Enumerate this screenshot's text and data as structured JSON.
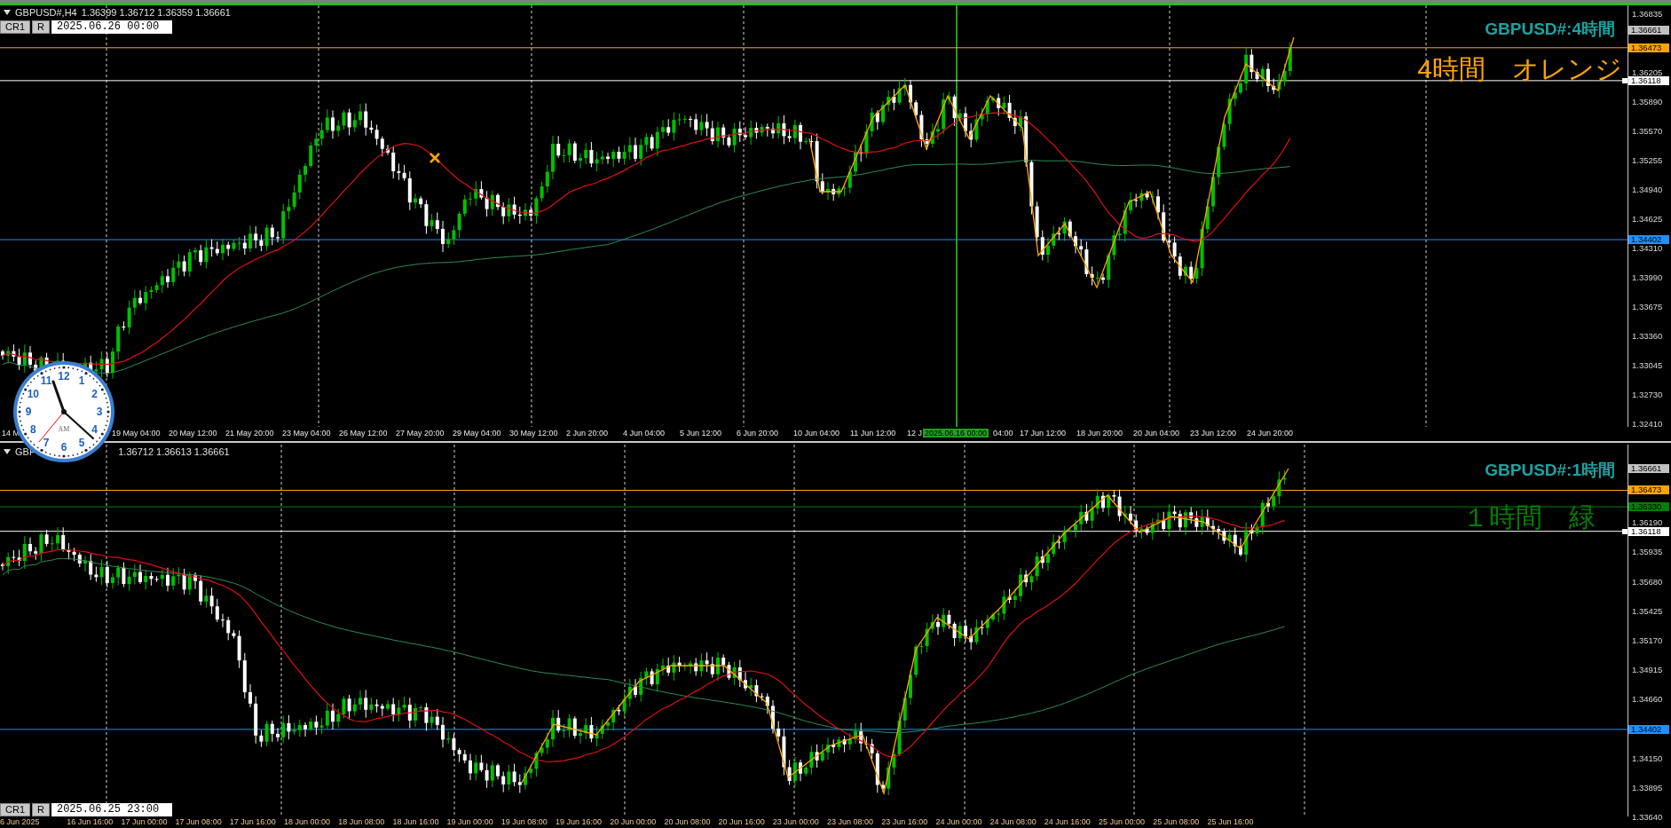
{
  "panes": [
    {
      "symbol": "GBPUSD#,H4",
      "quote": "1.36399 1.36712 1.36359 1.36661",
      "title": "GBPUSD#:4時間",
      "note": {
        "text": "4時間　オレンジ",
        "color": "#ffa500"
      },
      "toolbar": {
        "buttons": [
          "CR1",
          "R"
        ],
        "date": "2025.06.26 00:00"
      },
      "ticks": [
        "1.36835",
        "1.36205",
        "1.35890",
        "1.35570",
        "1.35255",
        "1.34940",
        "1.34625",
        "1.34310",
        "1.33990",
        "1.33675",
        "1.33360",
        "1.33045",
        "1.32730",
        "1.32410"
      ],
      "lines": [
        {
          "price": "1.36661",
          "color": "#c0c0c0",
          "kind": "tag"
        },
        {
          "price": "1.36473",
          "color": "#ffa500",
          "kind": "line"
        },
        {
          "price": "1.36118",
          "color": "#ffffff",
          "kind": "line"
        },
        {
          "price": "1.34402",
          "color": "#1e90ff",
          "kind": "line"
        }
      ],
      "time_labels": [
        {
          "text": "14 M",
          "kind": "tick"
        },
        {
          "text": "19 May 04:00",
          "kind": "tick"
        },
        {
          "text": "20 May 12:00",
          "kind": "tick"
        },
        {
          "text": "21 May 20:00",
          "kind": "tick"
        },
        {
          "text": "23 May 04:00",
          "kind": "tick"
        },
        {
          "text": "26 May 12:00",
          "kind": "tick"
        },
        {
          "text": "27 May 20:00",
          "kind": "tick"
        },
        {
          "text": "29 May 04:00",
          "kind": "tick"
        },
        {
          "text": "30 May 12:00",
          "kind": "tick"
        },
        {
          "text": "2 Jun 20:00",
          "kind": "tick"
        },
        {
          "text": "4 Jun 04:00",
          "kind": "tick"
        },
        {
          "text": "5 Jun 12:00",
          "kind": "tick"
        },
        {
          "text": "6 Jun 20:00",
          "kind": "tick"
        },
        {
          "text": "10 Jun 04:00",
          "kind": "tick"
        },
        {
          "text": "11 Jun 12:00",
          "kind": "tick"
        },
        {
          "text": "12 J",
          "kind": "tick"
        },
        {
          "text": "2025.06.16 00:00",
          "kind": "cursor"
        },
        {
          "text": "04:00",
          "kind": "tick"
        },
        {
          "text": "17 Jun 12:00",
          "kind": "tick"
        },
        {
          "text": "18 Jun 20:00",
          "kind": "tick"
        },
        {
          "text": "20 Jun 04:00",
          "kind": "tick"
        },
        {
          "text": "23 Jun 12:00",
          "kind": "tick"
        },
        {
          "text": "24 Jun 20:00",
          "kind": "tick"
        }
      ]
    },
    {
      "symbol": "GBP",
      "quote": "1.36712 1.36613 1.36661",
      "title": "GBPUSD#:1時間",
      "note": {
        "text": "１時間　緑",
        "color": "#008000"
      },
      "toolbar": {
        "buttons": [
          "CR1",
          "R"
        ],
        "date": "2025.06.25 23:00"
      },
      "ticks": [
        "1.36190",
        "1.35935",
        "1.35680",
        "1.35425",
        "1.35170",
        "1.34915",
        "1.34660",
        "1.34150",
        "1.33895",
        "1.33640"
      ],
      "lines": [
        {
          "price": "1.36661",
          "color": "#c0c0c0",
          "kind": "tag"
        },
        {
          "price": "1.36473",
          "color": "#ffa500",
          "kind": "line"
        },
        {
          "price": "1.36330",
          "color": "#008000",
          "kind": "line"
        },
        {
          "price": "1.36118",
          "color": "#ffffff",
          "kind": "line"
        },
        {
          "price": "1.34402",
          "color": "#1e90ff",
          "kind": "line"
        }
      ],
      "time_labels": [
        {
          "text": "6 Jun 2025",
          "kind": "tick"
        },
        {
          "text": "16 Jun 16:00",
          "kind": "tick"
        },
        {
          "text": "17 Jun 00:00",
          "kind": "tick"
        },
        {
          "text": "17 Jun 08:00",
          "kind": "tick"
        },
        {
          "text": "17 Jun 16:00",
          "kind": "tick"
        },
        {
          "text": "18 Jun 00:00",
          "kind": "tick"
        },
        {
          "text": "18 Jun 08:00",
          "kind": "tick"
        },
        {
          "text": "18 Jun 16:00",
          "kind": "tick"
        },
        {
          "text": "19 Jun 00:00",
          "kind": "tick"
        },
        {
          "text": "19 Jun 08:00",
          "kind": "tick"
        },
        {
          "text": "19 Jun 16:00",
          "kind": "tick"
        },
        {
          "text": "20 Jun 00:00",
          "kind": "tick"
        },
        {
          "text": "20 Jun 08:00",
          "kind": "tick"
        },
        {
          "text": "20 Jun 16:00",
          "kind": "tick"
        },
        {
          "text": "23 Jun 00:00",
          "kind": "tick"
        },
        {
          "text": "23 Jun 08:00",
          "kind": "tick"
        },
        {
          "text": "23 Jun 16:00",
          "kind": "tick"
        },
        {
          "text": "24 Jun 00:00",
          "kind": "tick"
        },
        {
          "text": "24 Jun 08:00",
          "kind": "tick"
        },
        {
          "text": "24 Jun 16:00",
          "kind": "tick"
        },
        {
          "text": "25 Jun 00:00",
          "kind": "tick"
        },
        {
          "text": "25 Jun 08:00",
          "kind": "tick"
        },
        {
          "text": "25 Jun 16:00",
          "kind": "tick"
        }
      ]
    }
  ],
  "clock": {
    "numbers": [
      "11",
      "12",
      "1",
      "10",
      "2",
      "9",
      "3",
      "8",
      "4",
      "7",
      "6",
      "5"
    ],
    "period": "AM"
  }
}
